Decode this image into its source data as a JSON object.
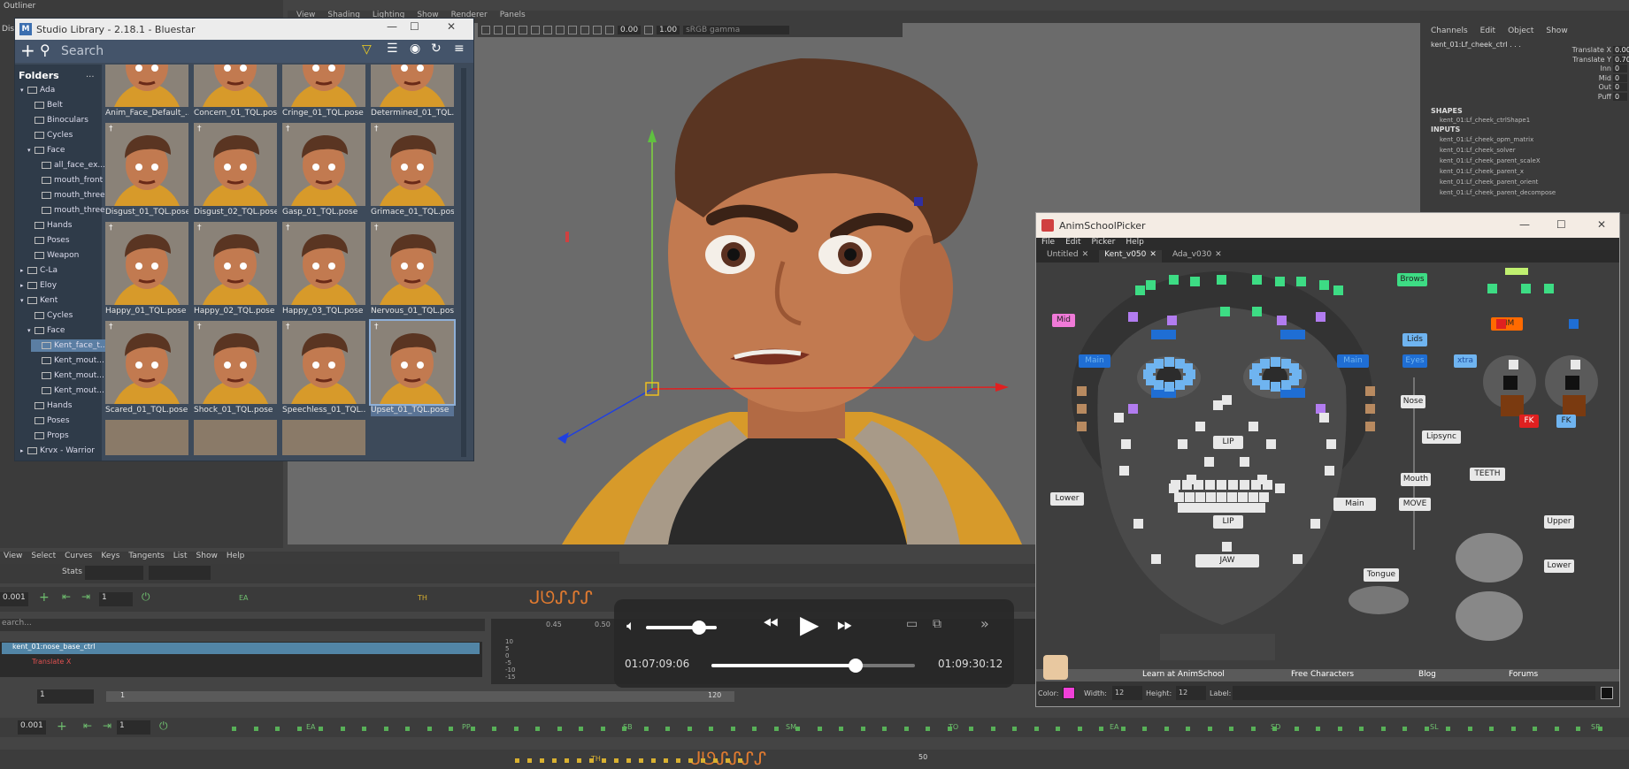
{
  "outliner": {
    "title": "Outliner",
    "sub": "Disp"
  },
  "viewport": {
    "menus": [
      "View",
      "Shading",
      "Lighting",
      "Show",
      "Renderer",
      "Panels"
    ],
    "exposure": "0.00",
    "gamma": "1.00",
    "colorspace": "sRGB gamma"
  },
  "channelbox": {
    "menus": [
      "Channels",
      "Edit",
      "Object",
      "Show"
    ],
    "node": "kent_01:Lf_cheek_ctrl . . .",
    "attrs": [
      {
        "name": "Translate X",
        "value": "0.00"
      },
      {
        "name": "Translate Y",
        "value": "0.70"
      },
      {
        "name": "Inn",
        "value": "0"
      },
      {
        "name": "Mid",
        "value": "0"
      },
      {
        "name": "Out",
        "value": "0"
      },
      {
        "name": "Puff",
        "value": "0"
      }
    ],
    "shapes_label": "SHAPES",
    "shape_item": "kent_01:Lf_cheek_ctrlShape1",
    "inputs_label": "INPUTS",
    "inputs": [
      "kent_01:Lf_cheek_opm_matrix",
      "kent_01:Lf_cheek_solver",
      "kent_01:Lf_cheek_parent_scaleX",
      "kent_01:Lf_cheek_parent_x",
      "kent_01:Lf_cheek_parent_orient",
      "kent_01:Lf_cheek_parent_decompose"
    ]
  },
  "studio": {
    "title": "Studio Library - 2.18.1 - Bluestar",
    "search_placeholder": "Search",
    "folders_label": "Folders",
    "folders_more": "...",
    "folders": [
      {
        "label": "Ada",
        "indent": 0,
        "expanded": true
      },
      {
        "label": "Belt",
        "indent": 1
      },
      {
        "label": "Binoculars",
        "indent": 1
      },
      {
        "label": "Cycles",
        "indent": 1
      },
      {
        "label": "Face",
        "indent": 1,
        "expanded": true
      },
      {
        "label": "all_face_ex...",
        "indent": 2
      },
      {
        "label": "mouth_front",
        "indent": 2
      },
      {
        "label": "mouth_three...",
        "indent": 2
      },
      {
        "label": "mouth_three...",
        "indent": 2
      },
      {
        "label": "Hands",
        "indent": 1
      },
      {
        "label": "Poses",
        "indent": 1
      },
      {
        "label": "Weapon",
        "indent": 1
      },
      {
        "label": "C-La",
        "indent": 0
      },
      {
        "label": "Eloy",
        "indent": 0
      },
      {
        "label": "Kent",
        "indent": 0,
        "expanded": true
      },
      {
        "label": "Cycles",
        "indent": 1
      },
      {
        "label": "Face",
        "indent": 1,
        "expanded": true
      },
      {
        "label": "Kent_face_t...",
        "indent": 2,
        "selected": true
      },
      {
        "label": "Kent_mout...",
        "indent": 2
      },
      {
        "label": "Kent_mout...",
        "indent": 2
      },
      {
        "label": "Kent_mout...",
        "indent": 2
      },
      {
        "label": "Hands",
        "indent": 1
      },
      {
        "label": "Poses",
        "indent": 1
      },
      {
        "label": "Props",
        "indent": 1
      },
      {
        "label": "Krvx - Warrior",
        "indent": 0
      }
    ],
    "poses": [
      "Anim_Face_Default_...",
      "Concern_01_TQL.pose",
      "Cringe_01_TQL.pose",
      "Determined_01_TQL...",
      "Disgust_01_TQL.pose",
      "Disgust_02_TQL.pose",
      "Gasp_01_TQL.pose",
      "Grimace_01_TQL.pose",
      "Happy_01_TQL.pose",
      "Happy_02_TQL.pose",
      "Happy_03_TQL.pose",
      "Nervous_01_TQL.pose",
      "Scared_01_TQL.pose",
      "Shock_01_TQL.pose",
      "Speechless_01_TQL...",
      "Upset_01_TQL.pose"
    ]
  },
  "picker": {
    "title": "AnimSchoolPicker",
    "menus": [
      "File",
      "Edit",
      "Picker",
      "Help"
    ],
    "tabs": [
      "Untitled",
      "Kent_v050",
      "Ada_v030"
    ],
    "buttons": {
      "mid": "Mid",
      "brows": "Brows",
      "aim": "AIM",
      "lids": "Lids",
      "eyes": "Eyes",
      "xtra": "xtra",
      "main_l": "Main",
      "main_r": "Main",
      "nose": "Nose",
      "lipsync": "Lipsync",
      "fk": "FK",
      "fk2": "FK",
      "lip_top": "LIP",
      "lip_bot": "LIP",
      "mouth": "Mouth",
      "teeth": "TEETH",
      "lower": "Lower",
      "main_mouth": "Main",
      "move": "MOVE",
      "upper": "Upper",
      "lower2": "Lower",
      "jaw": "JAW",
      "tongue": "Tongue"
    },
    "links": [
      "Learn at AnimSchool",
      "Free Characters",
      "Blog",
      "Forums"
    ],
    "footer": {
      "color_label": "Color:",
      "width_label": "Width:",
      "width_val": "12",
      "height_label": "Height:",
      "height_val": "12",
      "label_label": "Label:"
    },
    "colors": {
      "green": "#3ddc84",
      "purple": "#b27cf0",
      "blue": "#1f6ed4",
      "lightblue": "#6fb4f0",
      "pink": "#f07ad8",
      "red": "#e02020",
      "orange": "#ff6a00",
      "white": "#e8e8e8",
      "tan": "#b88a60"
    }
  },
  "graph": {
    "menus": [
      "View",
      "Select",
      "Curves",
      "Keys",
      "Tangents",
      "List",
      "Show",
      "Help"
    ],
    "stats_label": "Stats",
    "search_placeholder": "earch...",
    "selected_node": "kent_01:nose_base_ctrl",
    "sub_attr": "Translate X",
    "field_val": "0.001",
    "field_one": "1",
    "key_labels": [
      "EA",
      "TH"
    ],
    "ticks": [
      "0.45",
      "0.50"
    ],
    "y_ticks": [
      "10",
      "5",
      "0",
      "-5",
      "-10",
      "-15"
    ]
  },
  "timeline": {
    "start_field": "1",
    "range_start": "1",
    "range_end": "120",
    "field_val": "0.001",
    "field_one": "1",
    "labels": [
      "EA",
      "PP",
      "SB",
      "SM",
      "TO",
      "EA",
      "SD",
      "SL",
      "SR"
    ],
    "bottom_labels": [
      "TH",
      "50"
    ]
  },
  "player": {
    "current_time": "01:07:09:06",
    "total_time": "01:09:30:12",
    "volume": 0.75,
    "progress": 0.71
  }
}
